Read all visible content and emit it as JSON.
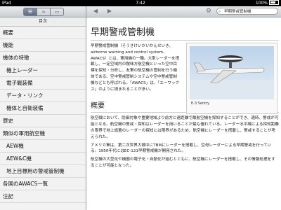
{
  "status_bar": {
    "device": "iPad",
    "time": "7:42",
    "battery": "100%"
  },
  "sidebar": {
    "title": "目次",
    "items": [
      {
        "label": "概要",
        "level": 1
      },
      {
        "label": "機能",
        "level": 1
      },
      {
        "label": "機体の特徴",
        "level": 1
      },
      {
        "label": "機上レーダー",
        "level": 2
      },
      {
        "label": "電子戦装備",
        "level": 2
      },
      {
        "label": "データ・リンク",
        "level": 2
      },
      {
        "label": "機体と自衛装備",
        "level": 2
      },
      {
        "label": "歴史",
        "level": 1
      },
      {
        "label": "類似の軍用航空機",
        "level": 1
      },
      {
        "label": "AEW機",
        "level": 2
      },
      {
        "label": "AEW&C機",
        "level": 2
      },
      {
        "label": "地上目標用の警戒管制機",
        "level": 2
      },
      {
        "label": "各国のAWACS一覧",
        "level": 1
      },
      {
        "label": "注記",
        "level": 1
      }
    ]
  },
  "navbar": {
    "back": "◀",
    "forward": "▶",
    "search_value": "早期警戒管制機"
  },
  "article": {
    "title": "早期警戒管制機",
    "intro": "早期警戒管制機（そうきけいかいかんせいき、airborne warning and control system、AWACS）とは、軍用機の一種。大型レーダーを搭載し、一定空域内の敵味方航空機といった空中目標を探知・分析し、友軍の航空機の管制を行う機体である。空中警戒管制システムや空中警戒管制機などとも呼ばれる。「AWACS」は、「エーワックス」のように読まれることが多い。",
    "figure_caption": "E-3 Sentry",
    "section_title": "概要",
    "paragraphs": [
      "航空戦において、防御対象や重要地域より前方に遠距離で敵航空機を探知することができ、適時、警戒が可能となる。航空機の警戒・探知はレーダーを用いることが最も優れている。レーダー水平線による探知距離の限界で地上設置のレーダーの探知には限界があるため、航空機にレーダーを搭載し、警戒することが考えられた。",
      "アメリカ軍は、第二次世界大戦中にTBMにレーダーを搭載し、空母レーダーによる早期警戒を行っている。1950年代にはEC-121早期警戒機が開発された。",
      "航空機の大型化や機器の電子化・自動化が進むとともに、航空機にレーダーを搭載し、その情報処理をすることが可能となった。"
    ]
  }
}
